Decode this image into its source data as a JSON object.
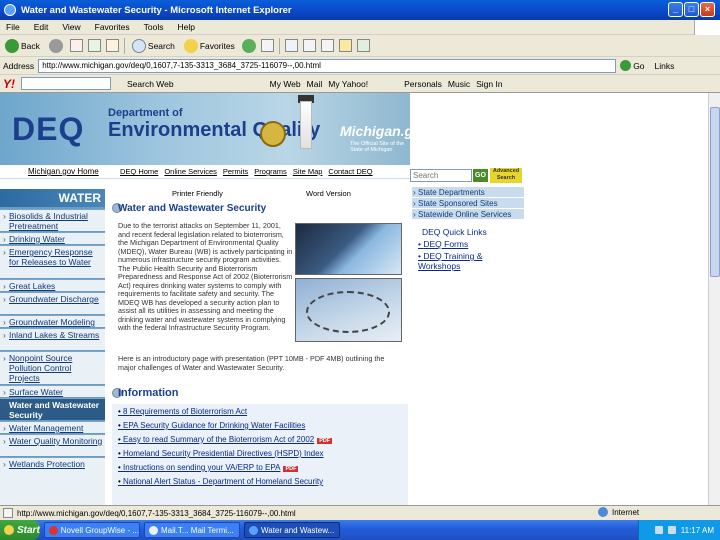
{
  "window": {
    "title": "Water and Wastewater Security - Microsoft Internet Explorer",
    "buttons": [
      "_",
      "□",
      "×"
    ]
  },
  "menu": [
    "File",
    "Edit",
    "View",
    "Favorites",
    "Tools",
    "Help"
  ],
  "toolbar": {
    "back": "Back",
    "search": "Search",
    "favorites": "Favorites"
  },
  "address": {
    "label": "Address",
    "url": "http://www.michigan.gov/deq/0,1607,7-135-3313_3684_3725-116079--,00.html",
    "go": "Go",
    "links": "Links"
  },
  "yahoo": {
    "logo": "Y!",
    "search_web": "Search Web",
    "items": [
      "My Web",
      "Mail",
      "My Yahoo!",
      "Personals",
      "Music",
      "Sign In"
    ]
  },
  "banner": {
    "deq": "DEQ",
    "department_of": "Department of",
    "env_quality": "Environmental Quality",
    "michigan": "Michigan.gov",
    "michigan_tagline": "The Official Site of the State of Michigan"
  },
  "util": {
    "michigan_home": "Michigan.gov Home",
    "nav": [
      "DEQ Home",
      "Online Services",
      "Permits",
      "Programs",
      "Site Map",
      "Contact DEQ"
    ]
  },
  "search": {
    "placeholder": "Search",
    "go": "GO",
    "advanced": "Advanced Search"
  },
  "leftnav": {
    "heading": "WATER",
    "items": [
      "Biosolids & Industrial Pretreatment",
      "Drinking Water",
      "Emergency Response for Releases to Water",
      "Great Lakes",
      "Groundwater Discharge",
      "Groundwater Modeling",
      "Inland Lakes & Streams",
      "Nonpoint Source Pollution Control Projects",
      "Surface Water",
      "Water and Wastewater Security",
      "Water Management",
      "Water Quality Monitoring",
      "Wetlands Protection"
    ],
    "active_index": 9
  },
  "content": {
    "printer_friendly": "Printer Friendly",
    "word_version": "Word Version",
    "heading": "Water and Wastewater Security",
    "body1": "Due to the terrorist attacks on September 11, 2001, and recent federal legislation related to bioterrorism, the Michigan Department of Environmental Quality (MDEQ), Water Bureau (WB) is actively participating in numerous infrastructure security program activities. The Public Health Security and Bioterrorism Preparedness and Response Act of 2002 (Bioterrorism Act) requires drinking water systems to comply with requirements to facilitate safety and security. The MDEQ WB has developed a security action plan to assist all its utilities in assessing and meeting the drinking water and wastewater systems in complying with the federal Infrastructure Security Program.",
    "body2": "Here is an introductory page with presentation (PPT 10MB - PDF 4MB) outlining the major challenges of Water and Wastewater Security.",
    "info_heading": "Information",
    "info_links": [
      "8 Requirements of Bioterrorism Act",
      "EPA Security Guidance for Drinking Water Facilities",
      "Easy to read Summary of the Bioterrorism Act of 2002",
      "Homeland Security Presidential Directives (HSPD) Index",
      "Instructions on sending your VA/ERP to EPA",
      "National Alert Status - Department of Homeland Security"
    ],
    "pdf_badge": "PDF"
  },
  "rightnav": {
    "items": [
      "State Departments",
      "State Sponsored Sites",
      "Statewide Online Services"
    ],
    "quick_title": "DEQ Quick Links",
    "quick_links": [
      "DEQ Forms",
      "DEQ Training & Workshops"
    ]
  },
  "status": {
    "text": "http://www.michigan.gov/deq/0,1607,7-135-3313_3684_3725-116079--,00.html",
    "zone": "Internet"
  },
  "taskbar": {
    "start": "Start",
    "tasks": [
      "Novell GroupWise - ...",
      "Mail.T... Mail Termi...",
      "Water and Wastew..."
    ],
    "active_index": 2,
    "clock": "11:17 AM"
  }
}
